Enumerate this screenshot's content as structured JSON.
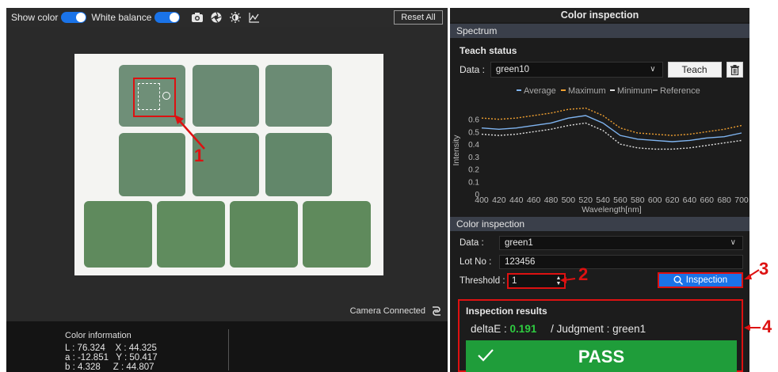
{
  "toolbar": {
    "show_color_label": "Show color",
    "white_balance_label": "White balance",
    "reset_all_label": "Reset All"
  },
  "camera": {
    "status_label": "Camera Connected"
  },
  "color_info": {
    "title": "Color information",
    "rows": [
      "L : 76.324    X : 44.325",
      "a : -12.851   Y : 50.417",
      "b : 4.328     Z : 44.807"
    ]
  },
  "panel": {
    "title": "Color inspection",
    "spectrum_section": "Spectrum",
    "teach_status_title": "Teach status",
    "teach_data_label": "Data :",
    "teach_data_value": "green10",
    "teach_button": "Teach",
    "color_inspection_section": "Color inspection",
    "data_label": "Data :",
    "data_value": "green1",
    "lot_label": "Lot No :",
    "lot_value": "123456",
    "threshold_label": "Threshold :",
    "threshold_value": "1",
    "inspection_button": "Inspection"
  },
  "results": {
    "title": "Inspection results",
    "delta_label": "deltaE :",
    "delta_value": "0.191",
    "judgment_text": "/ Judgment : green1",
    "verdict": "PASS"
  },
  "callouts": [
    "1",
    "2",
    "3",
    "4"
  ],
  "colors": {
    "accent": "#1a73e8",
    "pass_green": "#1f9d3a",
    "callout_red": "#dd1111",
    "average_line": "#7fb4f0",
    "maximum_line": "#f0a030",
    "minimum_line": "#e0e0e0",
    "reference_line": "#888888"
  },
  "chart_data": {
    "type": "line",
    "title": "",
    "xlabel": "Wavelength[nm]",
    "ylabel": "Intensity",
    "xlim": [
      400,
      700
    ],
    "ylim": [
      0,
      0.7
    ],
    "x_ticks": [
      400,
      420,
      440,
      460,
      480,
      500,
      520,
      540,
      560,
      580,
      600,
      620,
      640,
      660,
      680,
      700
    ],
    "y_ticks": [
      "0",
      "0.1",
      "0.2",
      "0.3",
      "0.4",
      "0.5",
      "0.6"
    ],
    "legend": [
      "Average",
      "Maximum",
      "Minimum",
      "Reference"
    ],
    "legend_position": "top",
    "x": [
      400,
      420,
      440,
      460,
      480,
      500,
      520,
      540,
      560,
      580,
      600,
      620,
      640,
      660,
      680,
      700
    ],
    "series": [
      {
        "name": "Average",
        "values": [
          0.53,
          0.52,
          0.53,
          0.55,
          0.57,
          0.61,
          0.63,
          0.57,
          0.47,
          0.44,
          0.43,
          0.42,
          0.43,
          0.45,
          0.46,
          0.49
        ]
      },
      {
        "name": "Maximum",
        "values": [
          0.61,
          0.6,
          0.61,
          0.63,
          0.65,
          0.68,
          0.69,
          0.63,
          0.53,
          0.49,
          0.48,
          0.47,
          0.48,
          0.5,
          0.52,
          0.55
        ]
      },
      {
        "name": "Minimum",
        "values": [
          0.48,
          0.47,
          0.48,
          0.5,
          0.52,
          0.55,
          0.57,
          0.51,
          0.4,
          0.37,
          0.36,
          0.36,
          0.37,
          0.39,
          0.41,
          0.43
        ]
      }
    ]
  }
}
